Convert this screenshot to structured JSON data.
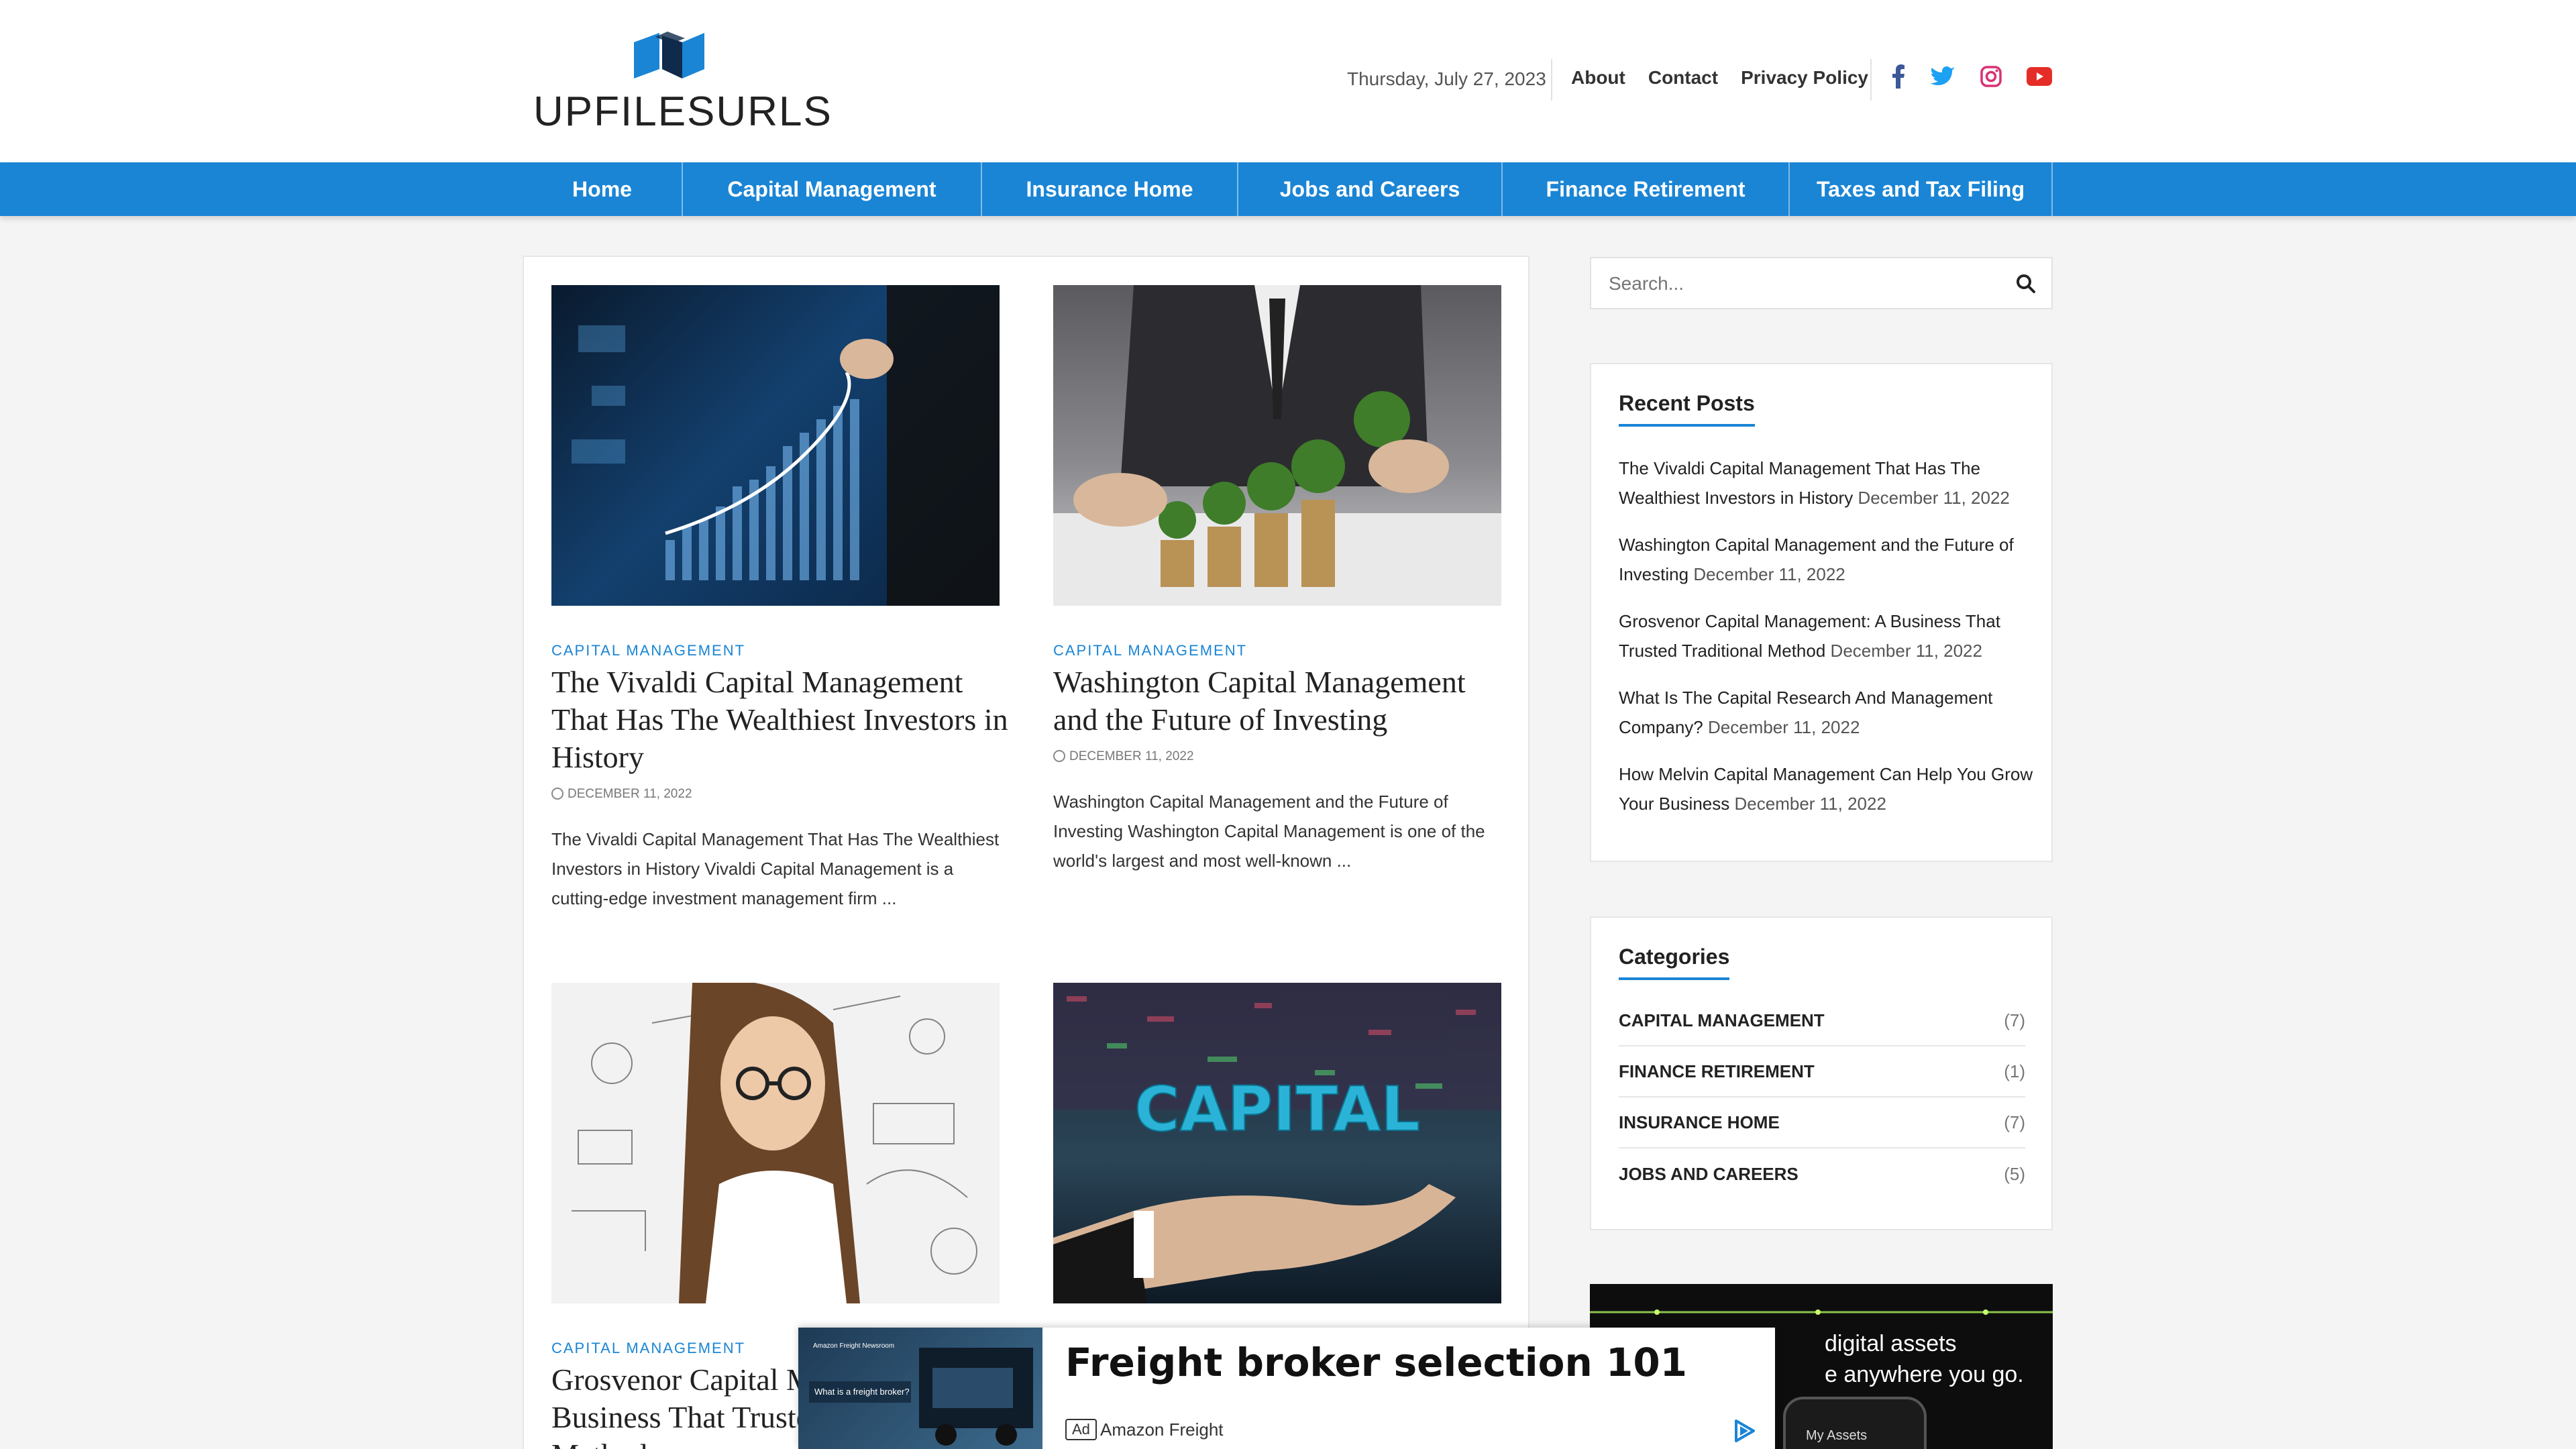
{
  "header": {
    "logo_text": "UPFILESURLS",
    "date": "Thursday, July 27, 2023",
    "links": [
      "About",
      "Contact",
      "Privacy Policy"
    ],
    "social_icons": [
      "facebook-icon",
      "twitter-icon",
      "instagram-icon",
      "youtube-icon"
    ]
  },
  "nav": {
    "items": [
      "Home",
      "Capital Management",
      "Insurance Home",
      "Jobs and Careers",
      "Finance Retirement",
      "Taxes and Tax Filing"
    ]
  },
  "posts": [
    {
      "category": "CAPITAL MANAGEMENT",
      "title": "The Vivaldi Capital Management That Has The Wealthiest Investors in History",
      "date": "DECEMBER 11, 2022",
      "excerpt": "The Vivaldi Capital Management That Has The Wealthiest Investors in History Vivaldi Capital Management is a cutting-edge investment management firm ..."
    },
    {
      "category": "CAPITAL MANAGEMENT",
      "title": "Washington Capital Management and the Future of Investing",
      "date": "DECEMBER 11, 2022",
      "excerpt": "Washington Capital Management and the Future of Investing Washington Capital Management is one of the world's largest and most well-known ..."
    },
    {
      "category": "CAPITAL MANAGEMENT",
      "title": "Grosvenor Capital Management: A Business That Trusted Traditional Method"
    },
    {
      "image_text": "CAPITAL"
    }
  ],
  "sidebar": {
    "search_placeholder": "Search...",
    "recent_title": "Recent Posts",
    "recent_posts": [
      {
        "title": "The Vivaldi Capital Management That Has The Wealthiest Investors in History",
        "date": "December 11, 2022"
      },
      {
        "title": "Washington Capital Management and the Future of Investing",
        "date": "December 11, 2022"
      },
      {
        "title": "Grosvenor Capital Management: A Business That Trusted Traditional Method",
        "date": "December 11, 2022"
      },
      {
        "title": "What Is The Capital Research And Management Company?",
        "date": "December 11, 2022"
      },
      {
        "title": "How Melvin Capital Management Can Help You Grow Your Business",
        "date": "December 11, 2022"
      }
    ],
    "categories_title": "Categories",
    "categories": [
      {
        "name": "CAPITAL MANAGEMENT",
        "count": "(7)"
      },
      {
        "name": "FINANCE RETIREMENT",
        "count": "(1)"
      },
      {
        "name": "INSURANCE HOME",
        "count": "(7)"
      },
      {
        "name": "JOBS AND CAREERS",
        "count": "(5)"
      }
    ],
    "promo_text_1": "digital assets",
    "promo_text_2": "e anywhere you go.",
    "promo_phone_label": "My Assets"
  },
  "ad": {
    "thumb_caption_1": "Amazon Freight Newsroom",
    "thumb_caption_2": "What is a freight broker?",
    "title": "Freight broker selection 101",
    "badge": "Ad",
    "advertiser": "Amazon Freight"
  },
  "colors": {
    "accent": "#1a85d5",
    "facebook": "#3b5998",
    "twitter": "#1da1f2",
    "instagram": "#d93175",
    "youtube": "#e52d27"
  }
}
